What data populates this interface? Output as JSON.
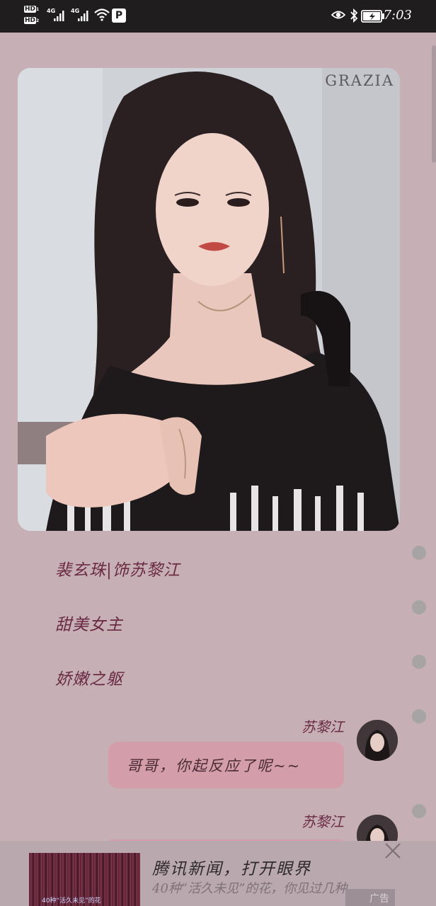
{
  "status_bar": {
    "sim1": "HD",
    "sim1_index": "1",
    "sim2": "HD",
    "sim2_index": "2",
    "network1": "4G",
    "network2": "4G",
    "app_badge": "P",
    "time": "7:03",
    "icons": [
      "signal-icon",
      "wifi-icon",
      "eye-icon",
      "bluetooth-icon",
      "battery-charging-icon"
    ]
  },
  "photo": {
    "brand_text": "GRAZIA"
  },
  "info": {
    "line1": "裴玄珠|饰苏黎江",
    "line2": "甜美女主",
    "line3": "娇嫩之躯"
  },
  "messages": [
    {
      "speaker": "苏黎江",
      "text": "哥哥，你起反应了呢~~"
    },
    {
      "speaker": "苏黎江",
      "text": ""
    }
  ],
  "ad": {
    "title": "腾讯新闻，打开眼界",
    "description": "40种“活久未见”的花，你见过几种",
    "thumb_caption": "40种“活久未见”的花",
    "tag": "广告"
  },
  "colors": {
    "background": "#c6b0b6",
    "text_accent": "#6b2a44",
    "bubble": "#d39ea9",
    "status_bar": "#1f1d1e"
  }
}
